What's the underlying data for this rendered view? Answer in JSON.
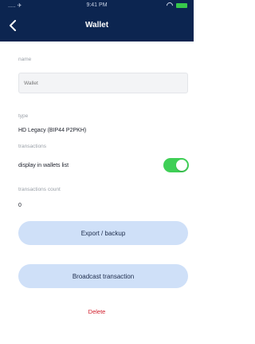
{
  "status_bar": {
    "time": "9:41 PM",
    "carrier": "..... ✈"
  },
  "header": {
    "title": "Wallet",
    "back_icon": "chevron-left-icon"
  },
  "fields": {
    "name_label": "name",
    "name_placeholder": "Wallet",
    "type_label": "type",
    "type_value": "HD Legacy (BIP44 P2PKH)",
    "transactions_label": "transactions",
    "display_in_list_label": "display in wallets list",
    "display_in_list_on": true,
    "tx_count_label": "transactions count",
    "tx_count_value": "0"
  },
  "actions": {
    "export_label": "Export / backup",
    "broadcast_label": "Broadcast transaction",
    "delete_label": "Delete"
  },
  "colors": {
    "header_bg": "#0c2550",
    "toggle_on": "#3fcf56",
    "pill_bg": "#cfe0f8",
    "delete": "#d11f2d"
  }
}
